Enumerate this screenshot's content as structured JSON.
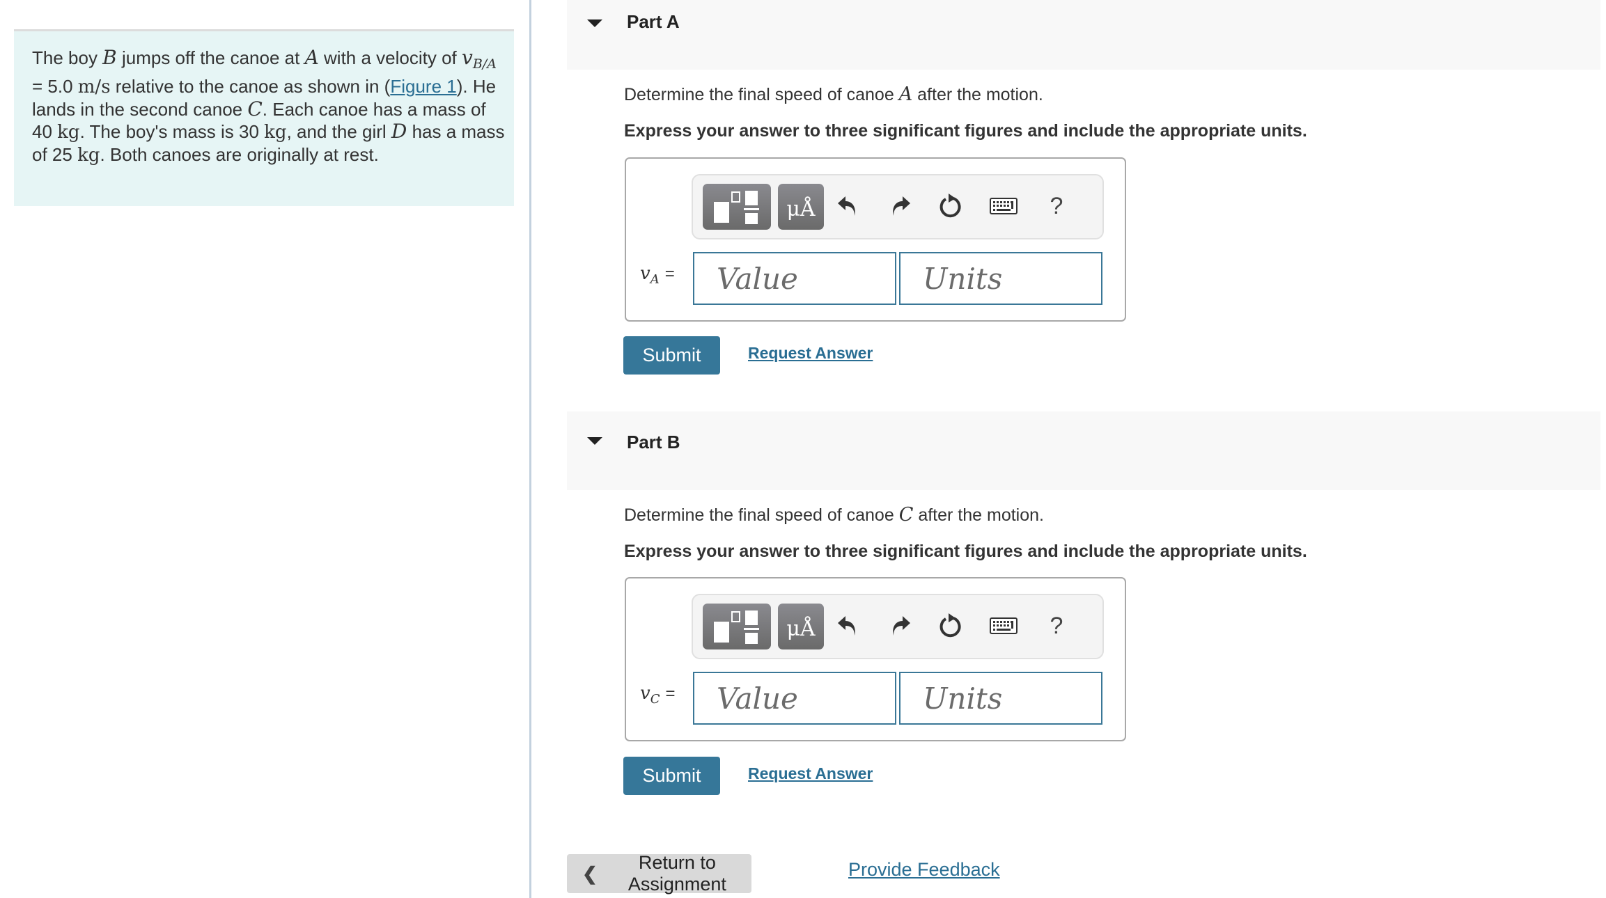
{
  "problem": {
    "segments": [
      {
        "t": "text",
        "v": "The boy "
      },
      {
        "t": "mi",
        "v": "B"
      },
      {
        "t": "text",
        "v": " jumps off the canoe at "
      },
      {
        "t": "mi",
        "v": "A"
      },
      {
        "t": "text",
        "v": " with a velocity of "
      },
      {
        "t": "mi",
        "v": "v"
      },
      {
        "t": "sub",
        "v": "B/A"
      },
      {
        "t": "text",
        "v": " = 5.0 "
      },
      {
        "t": "mr",
        "v": "m/s"
      },
      {
        "t": "text",
        "v": " relative to the canoe as shown in ("
      },
      {
        "t": "link",
        "v": "Figure 1"
      },
      {
        "t": "text",
        "v": "). He lands in the second canoe "
      },
      {
        "t": "mi",
        "v": "C"
      },
      {
        "t": "text",
        "v": ". Each canoe has a mass of 40 "
      },
      {
        "t": "mr",
        "v": "kg"
      },
      {
        "t": "text",
        "v": ". The boy's mass is 30 "
      },
      {
        "t": "mr",
        "v": "kg"
      },
      {
        "t": "text",
        "v": ", and the girl "
      },
      {
        "t": "mi",
        "v": "D"
      },
      {
        "t": "text",
        "v": " has a mass of 25 "
      },
      {
        "t": "mr",
        "v": "kg"
      },
      {
        "t": "text",
        "v": ". Both canoes are originally at rest."
      }
    ]
  },
  "parts": [
    {
      "title": "Part A",
      "prompt_before": "Determine the final speed of canoe ",
      "prompt_var": "A",
      "prompt_after": " after the motion.",
      "instruction": "Express your answer to three significant figures and include the appropriate units.",
      "var_symbol": "v",
      "var_sub": "A",
      "equals": "=",
      "value_placeholder": "Value",
      "units_placeholder": "Units",
      "submit_label": "Submit",
      "request_label": "Request Answer"
    },
    {
      "title": "Part B",
      "prompt_before": "Determine the final speed of canoe ",
      "prompt_var": "C",
      "prompt_after": " after the motion.",
      "instruction": "Express your answer to three significant figures and include the appropriate units.",
      "var_symbol": "v",
      "var_sub": "C",
      "equals": "=",
      "value_placeholder": "Value",
      "units_placeholder": "Units",
      "submit_label": "Submit",
      "request_label": "Request Answer"
    }
  ],
  "toolbar": {
    "units_button_label": "μÅ",
    "help_label": "?",
    "icons": [
      "templates-icon",
      "units-icon",
      "undo-icon",
      "redo-icon",
      "reset-icon",
      "keyboard-icon",
      "help-icon"
    ]
  },
  "footer": {
    "return_label": "Return to Assignment",
    "feedback_label": "Provide Feedback"
  },
  "colors": {
    "accent": "#367799",
    "link": "#2a6e93",
    "problem_bg": "#e6f5f5",
    "part_header_bg": "#f8f8f8"
  }
}
